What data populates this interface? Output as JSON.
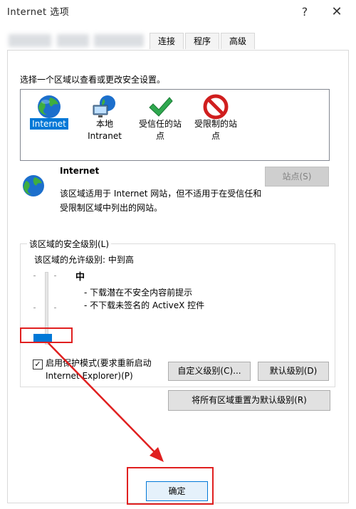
{
  "window": {
    "title": "Internet 选项",
    "help_label": "?",
    "close_label": "✕"
  },
  "tabs": [
    {
      "label": "连接"
    },
    {
      "label": "程序"
    },
    {
      "label": "高级"
    }
  ],
  "zones": {
    "prompt": "选择一个区域以查看或更改安全设置。",
    "items": [
      {
        "label": "Internet",
        "icon": "globe-icon",
        "selected": true
      },
      {
        "label": "本地\nIntranet",
        "icon": "intranet-icon",
        "selected": false
      },
      {
        "label": "受信任的站\n点",
        "icon": "checkmark-icon",
        "selected": false
      },
      {
        "label": "受限制的站\n点",
        "icon": "restricted-icon",
        "selected": false
      }
    ]
  },
  "zone_detail": {
    "title": "Internet",
    "description": "该区域适用于 Internet 网站，但不适用于在受信任和受限制区域中列出的网站。",
    "sites_button": "站点(S)"
  },
  "security_level": {
    "group_label": "该区域的安全级别(L)",
    "allowed_levels": "该区域的允许级别: 中到高",
    "level_name": "中",
    "level_desc_1": "- 下载潜在不安全内容前提示",
    "level_desc_2": "- 不下载未签名的 ActiveX 控件",
    "protected_mode_label_1": "启用保护模式(要求重新启动",
    "protected_mode_label_2": "Internet Explorer)(P)",
    "protected_mode_checked": true,
    "custom_level_button": "自定义级别(C)...",
    "default_level_button": "默认级别(D)",
    "reset_all_button": "将所有区域重置为默认级别(R)"
  },
  "footer": {
    "ok_button": "确定"
  },
  "colors": {
    "accent": "#0078d7",
    "annotation": "#e02020"
  }
}
